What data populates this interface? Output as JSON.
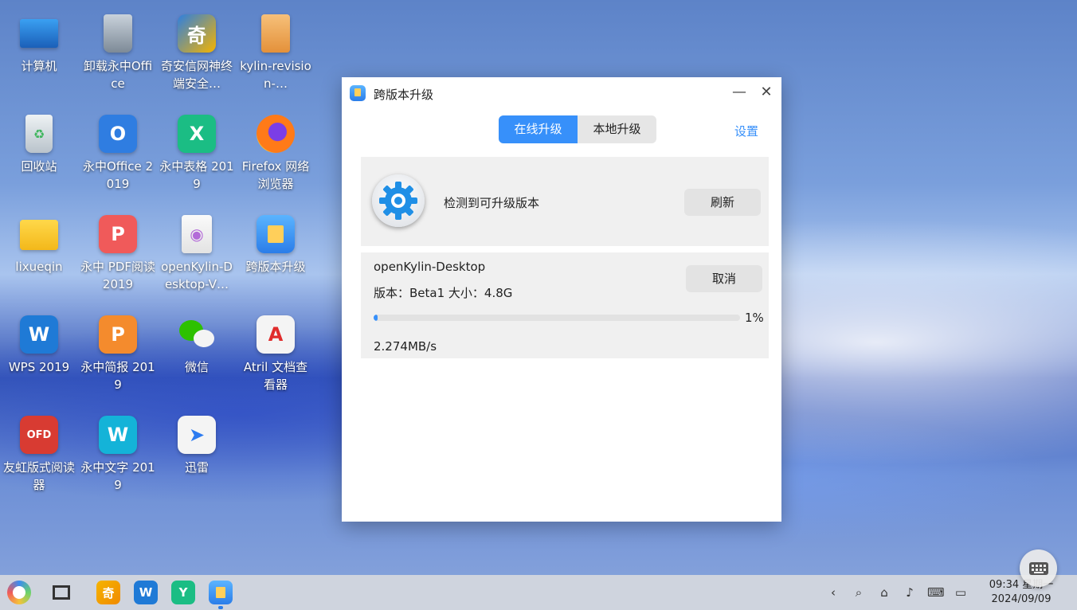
{
  "desktop": {
    "icons": [
      {
        "label": "计算机",
        "icon": "computer-icon"
      },
      {
        "label": "卸载永中Office",
        "icon": "trash-bin-icon"
      },
      {
        "label": "奇安信网神终端安全…",
        "icon": "qianxin-icon"
      },
      {
        "label": "kylin-revision-…",
        "icon": "archive-icon"
      },
      {
        "label": "回收站",
        "icon": "recycle-bin-icon"
      },
      {
        "label": "永中Office 2019",
        "icon": "yozo-office-icon"
      },
      {
        "label": "永中表格 2019",
        "icon": "yozo-sheet-icon"
      },
      {
        "label": "Firefox 网络浏览器",
        "icon": "firefox-icon"
      },
      {
        "label": "lixueqin",
        "icon": "home-folder-icon"
      },
      {
        "label": "永中 PDF阅读 2019",
        "icon": "yozo-pdf-icon"
      },
      {
        "label": "openKylin-Desktop-V…",
        "icon": "disc-image-icon"
      },
      {
        "label": "跨版本升级",
        "icon": "upgrade-icon"
      },
      {
        "label": "WPS 2019",
        "icon": "wps-icon"
      },
      {
        "label": "永中简报 2019",
        "icon": "yozo-slides-icon"
      },
      {
        "label": "微信",
        "icon": "wechat-icon"
      },
      {
        "label": "Atril 文档查看器",
        "icon": "atril-icon"
      },
      {
        "label": "友虹版式阅读器",
        "icon": "ofd-reader-icon"
      },
      {
        "label": "永中文字 2019",
        "icon": "yozo-writer-icon"
      },
      {
        "label": "迅雷",
        "icon": "thunder-icon"
      }
    ]
  },
  "window": {
    "title": "跨版本升级",
    "minimize_glyph": "—",
    "close_glyph": "✕",
    "tabs": [
      {
        "label": "在线升级",
        "active": true
      },
      {
        "label": "本地升级",
        "active": false
      }
    ],
    "settings_label": "设置",
    "detect": {
      "message": "检测到可升级版本",
      "refresh_label": "刷新"
    },
    "package": {
      "name": "openKylin-Desktop",
      "meta": "版本：Beta1  大小：4.8G",
      "cancel_label": "取消",
      "progress_percent": 1,
      "progress_label": "1%",
      "speed": "2.274MB/s"
    }
  },
  "taskbar": {
    "apps": [
      "start-menu-icon",
      "multitask-view-icon",
      "qianxin-icon",
      "wps-icon",
      "yozo-app-icon",
      "upgrade-icon"
    ],
    "tray": [
      "chevron-left-icon",
      "search-icon",
      "network-icon",
      "volume-icon",
      "input-method-icon",
      "notification-icon"
    ],
    "clock": {
      "time": "09:34 星期一",
      "date": "2024/09/09"
    }
  },
  "colors": {
    "accent": "#3790fa",
    "panel": "#f0f0f0"
  }
}
